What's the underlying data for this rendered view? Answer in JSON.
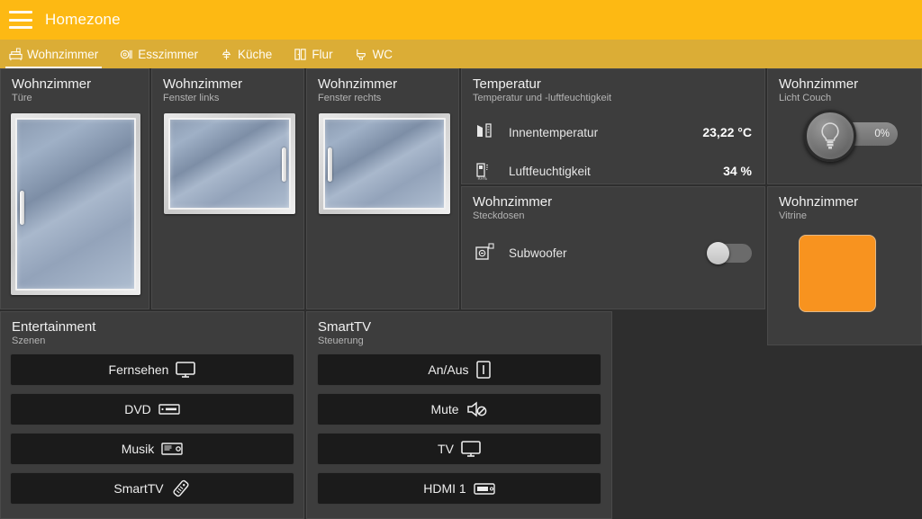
{
  "header": {
    "title": "Homezone",
    "menu_icon": "hamburger-menu-icon"
  },
  "tabs": [
    {
      "label": "Wohnzimmer",
      "icon": "sofa-icon",
      "active": true
    },
    {
      "label": "Esszimmer",
      "icon": "dining-table-icon",
      "active": false
    },
    {
      "label": "Küche",
      "icon": "kitchen-icon",
      "active": false
    },
    {
      "label": "Flur",
      "icon": "door-hall-icon",
      "active": false
    },
    {
      "label": "WC",
      "icon": "toilet-icon",
      "active": false
    }
  ],
  "panels": {
    "door": {
      "title": "Wohnzimmer",
      "subtitle": "Türe",
      "widget": "door-graphic",
      "state": "closed",
      "handle_side": "left"
    },
    "window_left": {
      "title": "Wohnzimmer",
      "subtitle": "Fenster links",
      "widget": "window-graphic",
      "state": "closed",
      "handle_side": "right"
    },
    "window_right": {
      "title": "Wohnzimmer",
      "subtitle": "Fenster rechts",
      "widget": "window-graphic",
      "state": "closed",
      "handle_side": "left"
    },
    "temperature": {
      "title": "Temperatur",
      "subtitle": "Temperatur und -luftfeuchtigkeit",
      "rows": [
        {
          "icon": "thermometer-icon",
          "label": "Innentemperatur",
          "value": "23,22 °C"
        },
        {
          "icon": "humidity-sensor-icon",
          "label": "Luftfeuchtigkeit",
          "value": "34 %"
        }
      ]
    },
    "sockets": {
      "title": "Wohnzimmer",
      "subtitle": "Steckdosen",
      "rows": [
        {
          "icon": "power-socket-icon",
          "label": "Subwoofer",
          "toggle": "off"
        }
      ]
    },
    "light_couch": {
      "title": "Wohnzimmer",
      "subtitle": "Licht Couch",
      "icon": "lightbulb-icon",
      "value": "0%",
      "brightness": 0
    },
    "vitrine": {
      "title": "Wohnzimmer",
      "subtitle": "Vitrine",
      "color": "#F8931F",
      "border_color": "#e0b888"
    },
    "entertainment": {
      "title": "Entertainment",
      "subtitle": "Szenen",
      "buttons": [
        {
          "label": "Fernsehen",
          "icon": "tv-icon"
        },
        {
          "label": "DVD",
          "icon": "dvd-player-icon"
        },
        {
          "label": "Musik",
          "icon": "receiver-icon"
        },
        {
          "label": "SmartTV",
          "icon": "remote-control-icon"
        }
      ]
    },
    "smarttv": {
      "title": "SmartTV",
      "subtitle": "Steuerung",
      "buttons": [
        {
          "label": "An/Aus",
          "icon": "power-switch-icon"
        },
        {
          "label": "Mute",
          "icon": "speaker-mute-icon"
        },
        {
          "label": "TV",
          "icon": "tv-icon"
        },
        {
          "label": "HDMI 1",
          "icon": "hdmi-icon"
        }
      ]
    }
  },
  "colors": {
    "header_bg": "#fdb913",
    "tabbar_bg": "#dbad36",
    "page_bg": "#2e2e2e",
    "panel_bg": "#3d3d3d",
    "button_bg": "#1b1b1b",
    "accent_orange": "#F8931F"
  }
}
